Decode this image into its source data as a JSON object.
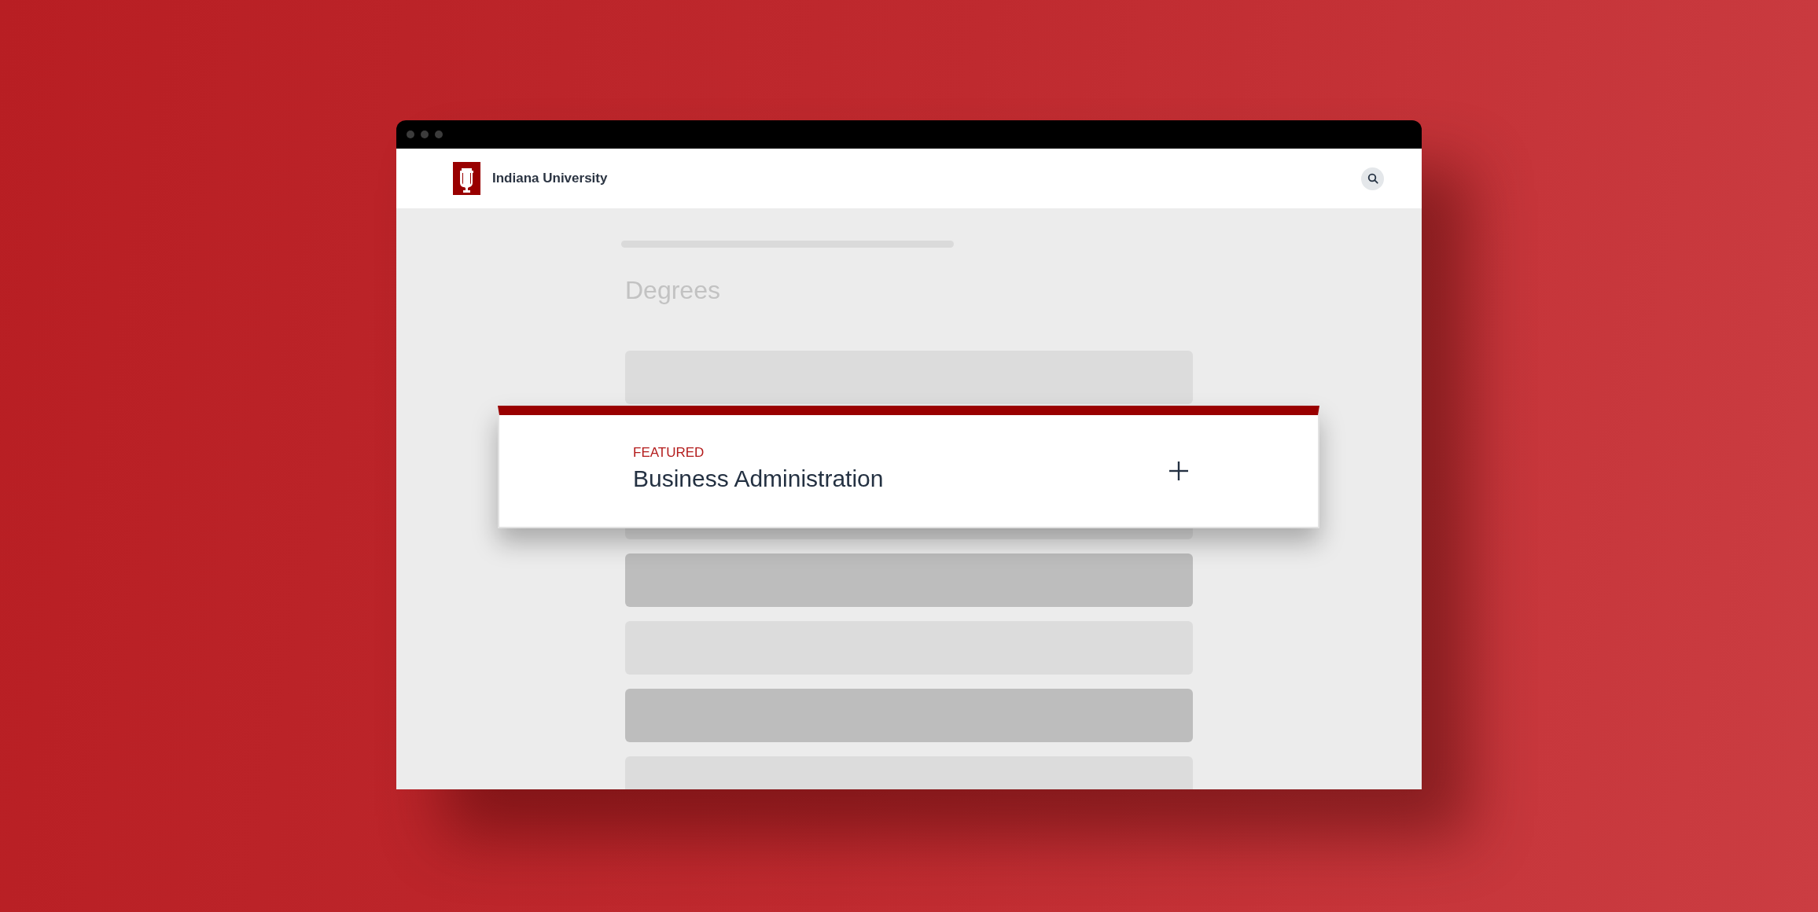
{
  "header": {
    "site_name": "Indiana University"
  },
  "page": {
    "title": "Degrees"
  },
  "placeholders": [
    {
      "kind": "light"
    },
    {
      "kind": "light"
    },
    {
      "kind": "dark"
    },
    {
      "kind": "light"
    },
    {
      "kind": "dark"
    },
    {
      "kind": "light"
    }
  ],
  "featured_card": {
    "label": "FEATURED",
    "title": "Business Administration",
    "expanded": false
  }
}
